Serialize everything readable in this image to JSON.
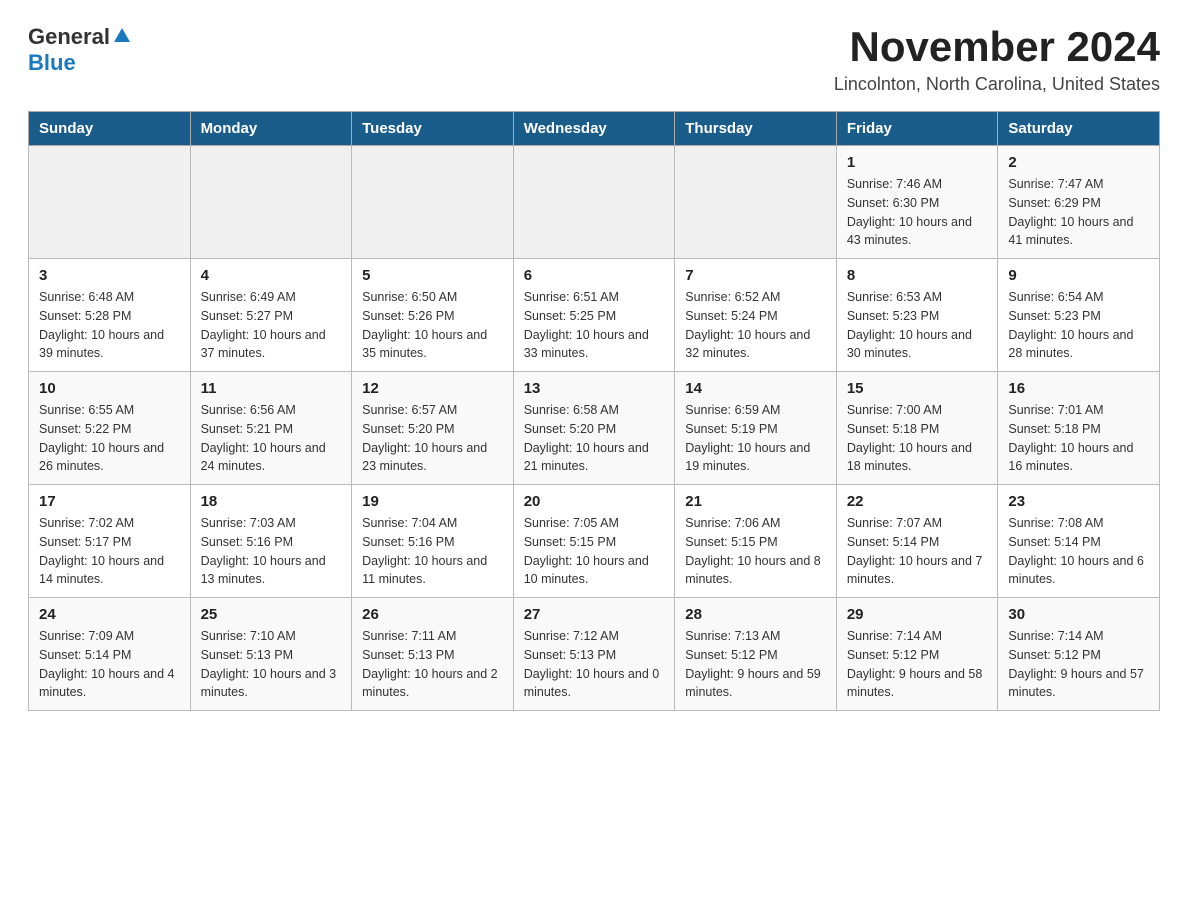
{
  "header": {
    "logo_general": "General",
    "logo_blue": "Blue",
    "month_title": "November 2024",
    "location": "Lincolnton, North Carolina, United States"
  },
  "days_of_week": [
    "Sunday",
    "Monday",
    "Tuesday",
    "Wednesday",
    "Thursday",
    "Friday",
    "Saturday"
  ],
  "weeks": [
    [
      {
        "day": "",
        "detail": ""
      },
      {
        "day": "",
        "detail": ""
      },
      {
        "day": "",
        "detail": ""
      },
      {
        "day": "",
        "detail": ""
      },
      {
        "day": "",
        "detail": ""
      },
      {
        "day": "1",
        "detail": "Sunrise: 7:46 AM\nSunset: 6:30 PM\nDaylight: 10 hours and 43 minutes."
      },
      {
        "day": "2",
        "detail": "Sunrise: 7:47 AM\nSunset: 6:29 PM\nDaylight: 10 hours and 41 minutes."
      }
    ],
    [
      {
        "day": "3",
        "detail": "Sunrise: 6:48 AM\nSunset: 5:28 PM\nDaylight: 10 hours and 39 minutes."
      },
      {
        "day": "4",
        "detail": "Sunrise: 6:49 AM\nSunset: 5:27 PM\nDaylight: 10 hours and 37 minutes."
      },
      {
        "day": "5",
        "detail": "Sunrise: 6:50 AM\nSunset: 5:26 PM\nDaylight: 10 hours and 35 minutes."
      },
      {
        "day": "6",
        "detail": "Sunrise: 6:51 AM\nSunset: 5:25 PM\nDaylight: 10 hours and 33 minutes."
      },
      {
        "day": "7",
        "detail": "Sunrise: 6:52 AM\nSunset: 5:24 PM\nDaylight: 10 hours and 32 minutes."
      },
      {
        "day": "8",
        "detail": "Sunrise: 6:53 AM\nSunset: 5:23 PM\nDaylight: 10 hours and 30 minutes."
      },
      {
        "day": "9",
        "detail": "Sunrise: 6:54 AM\nSunset: 5:23 PM\nDaylight: 10 hours and 28 minutes."
      }
    ],
    [
      {
        "day": "10",
        "detail": "Sunrise: 6:55 AM\nSunset: 5:22 PM\nDaylight: 10 hours and 26 minutes."
      },
      {
        "day": "11",
        "detail": "Sunrise: 6:56 AM\nSunset: 5:21 PM\nDaylight: 10 hours and 24 minutes."
      },
      {
        "day": "12",
        "detail": "Sunrise: 6:57 AM\nSunset: 5:20 PM\nDaylight: 10 hours and 23 minutes."
      },
      {
        "day": "13",
        "detail": "Sunrise: 6:58 AM\nSunset: 5:20 PM\nDaylight: 10 hours and 21 minutes."
      },
      {
        "day": "14",
        "detail": "Sunrise: 6:59 AM\nSunset: 5:19 PM\nDaylight: 10 hours and 19 minutes."
      },
      {
        "day": "15",
        "detail": "Sunrise: 7:00 AM\nSunset: 5:18 PM\nDaylight: 10 hours and 18 minutes."
      },
      {
        "day": "16",
        "detail": "Sunrise: 7:01 AM\nSunset: 5:18 PM\nDaylight: 10 hours and 16 minutes."
      }
    ],
    [
      {
        "day": "17",
        "detail": "Sunrise: 7:02 AM\nSunset: 5:17 PM\nDaylight: 10 hours and 14 minutes."
      },
      {
        "day": "18",
        "detail": "Sunrise: 7:03 AM\nSunset: 5:16 PM\nDaylight: 10 hours and 13 minutes."
      },
      {
        "day": "19",
        "detail": "Sunrise: 7:04 AM\nSunset: 5:16 PM\nDaylight: 10 hours and 11 minutes."
      },
      {
        "day": "20",
        "detail": "Sunrise: 7:05 AM\nSunset: 5:15 PM\nDaylight: 10 hours and 10 minutes."
      },
      {
        "day": "21",
        "detail": "Sunrise: 7:06 AM\nSunset: 5:15 PM\nDaylight: 10 hours and 8 minutes."
      },
      {
        "day": "22",
        "detail": "Sunrise: 7:07 AM\nSunset: 5:14 PM\nDaylight: 10 hours and 7 minutes."
      },
      {
        "day": "23",
        "detail": "Sunrise: 7:08 AM\nSunset: 5:14 PM\nDaylight: 10 hours and 6 minutes."
      }
    ],
    [
      {
        "day": "24",
        "detail": "Sunrise: 7:09 AM\nSunset: 5:14 PM\nDaylight: 10 hours and 4 minutes."
      },
      {
        "day": "25",
        "detail": "Sunrise: 7:10 AM\nSunset: 5:13 PM\nDaylight: 10 hours and 3 minutes."
      },
      {
        "day": "26",
        "detail": "Sunrise: 7:11 AM\nSunset: 5:13 PM\nDaylight: 10 hours and 2 minutes."
      },
      {
        "day": "27",
        "detail": "Sunrise: 7:12 AM\nSunset: 5:13 PM\nDaylight: 10 hours and 0 minutes."
      },
      {
        "day": "28",
        "detail": "Sunrise: 7:13 AM\nSunset: 5:12 PM\nDaylight: 9 hours and 59 minutes."
      },
      {
        "day": "29",
        "detail": "Sunrise: 7:14 AM\nSunset: 5:12 PM\nDaylight: 9 hours and 58 minutes."
      },
      {
        "day": "30",
        "detail": "Sunrise: 7:14 AM\nSunset: 5:12 PM\nDaylight: 9 hours and 57 minutes."
      }
    ]
  ]
}
